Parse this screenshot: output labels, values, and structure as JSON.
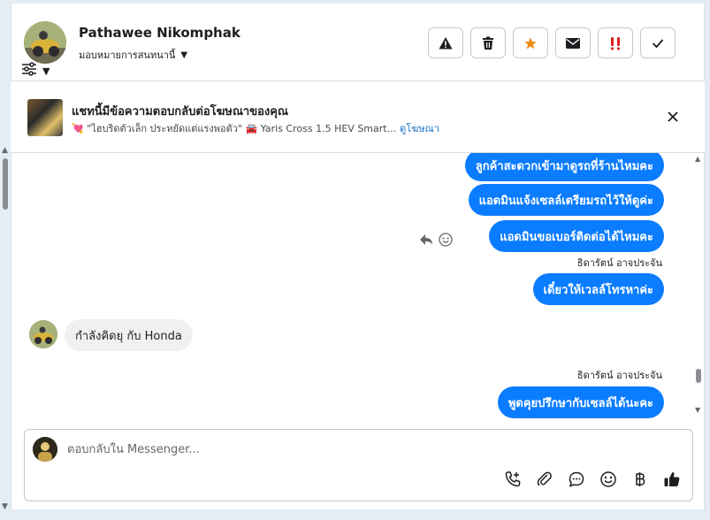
{
  "header": {
    "contact_name": "Pathawee Nikomphak",
    "assign_label": "มอบหมายการสนทนานี้",
    "actions": [
      {
        "name": "spam-button",
        "icon": "warning-icon"
      },
      {
        "name": "delete-button",
        "icon": "trash-icon"
      },
      {
        "name": "star-button",
        "icon": "star-icon"
      },
      {
        "name": "mark-unread-button",
        "icon": "envelope-icon"
      },
      {
        "name": "follow-up-button",
        "icon": "exclamation-icon"
      },
      {
        "name": "mark-done-button",
        "icon": "checkmark-icon"
      }
    ]
  },
  "ad_banner": {
    "title": "แชทนี้มีข้อความตอบกลับต่อโฆษณาของคุณ",
    "subtitle": "💘 \"ไฮบริดตัวเล็ก ประหยัดแต่แรงพอตัว\" 🚘 Yaris Cross 1.5 HEV Smart...",
    "link": "ดูโฆษณา"
  },
  "messages": {
    "out1": "ลูกค้าสะดวกเข้ามาดูรถที่ร้านไหมคะ",
    "out2": "แอดมินแจ้งเซลล์เตรียมรถไว้ให้ดูค่ะ",
    "out3": "แอดมินขอเบอร์ติดต่อได้ไหมคะ",
    "sender1": "ธิดารัตน์ อาจประจัน",
    "out4": "เดี๋ยวให้เวลล์โทรหาค่ะ",
    "in1": "กำลังคิดยุ กับ Honda",
    "sender2": "ธิดารัตน์ อาจประจัน",
    "out5": "พูดคุยปรึกษากับเซลล์ได้นะคะ"
  },
  "composer": {
    "placeholder": "ตอบกลับใน Messenger..."
  },
  "colors": {
    "accent": "#0a7cff",
    "star": "#f08c1e",
    "alert": "#e02020"
  }
}
